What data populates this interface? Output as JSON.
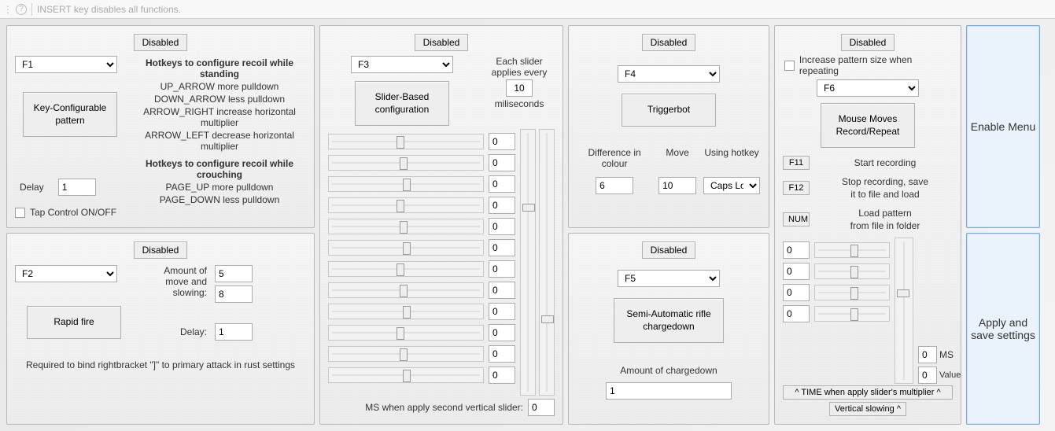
{
  "topbar": {
    "hint": "INSERT key disables all functions."
  },
  "common": {
    "disabled": "Disabled"
  },
  "p1": {
    "hotkey": "F1",
    "btn": "Key-Configurable pattern",
    "h1": "Hotkeys to configure recoil while standing",
    "l1": "UP_ARROW more pulldown",
    "l2": "DOWN_ARROW less pulldown",
    "l3": "ARROW_RIGHT increase horizontal multiplier",
    "l4": "ARROW_LEFT decrease horizontal multiplier",
    "h2": "Hotkeys to configure recoil while crouching",
    "l5": "PAGE_UP more pulldown",
    "l6": "PAGE_DOWN less pulldown",
    "delayLabel": "Delay",
    "delay": "1",
    "tap": "Tap Control ON/OFF"
  },
  "p2": {
    "hotkey": "F2",
    "btn": "Rapid fire",
    "amountLabel": "Amount of move and slowing:",
    "amount1": "5",
    "amount2": "8",
    "delayLabel": "Delay:",
    "delay": "1",
    "note": "Required to bind rightbracket \"]\" to primary attack in rust settings"
  },
  "p3": {
    "hotkey": "F3",
    "btn": "Slider-Based configuration",
    "note1a": "Each slider",
    "note1b": "applies every",
    "ms": "10",
    "note1c": "miliseconds",
    "rows": [
      "0",
      "0",
      "0",
      "0",
      "0",
      "0",
      "0",
      "0",
      "0",
      "0",
      "0",
      "0"
    ],
    "footer": "MS when apply second vertical slider:",
    "footerVal": "0"
  },
  "p4": {
    "hotkey": "F4",
    "btn": "Triggerbot",
    "col1": "Difference in colour",
    "col2": "Move",
    "col3": "Using hotkey",
    "v1": "6",
    "v2": "10",
    "v3": "Caps Lock"
  },
  "p5": {
    "hotkey": "F5",
    "btn": "Semi-Automatic rifle chargedown",
    "label": "Amount of chargedown",
    "val": "1"
  },
  "p6": {
    "chk": "Increase pattern size when repeating",
    "hotkey": "F6",
    "btn": "Mouse Moves Record/Repeat",
    "k1": "F11",
    "t1": "Start recording",
    "k2": "F12",
    "t2a": "Stop recording, save",
    "t2b": "it to file and load",
    "k3": "NUM",
    "t3a": "Load pattern",
    "t3b": "from file in folder",
    "row1": "0",
    "row2": "0",
    "row3": "0",
    "row4": "0",
    "msLabel": "MS",
    "msVal": "0",
    "valueLabel": "Value",
    "valueVal": "0",
    "foot1": "^ TIME when apply slider's multiplier ^",
    "foot2": "Vertical slowing ^"
  },
  "side": {
    "enable": "Enable Menu",
    "apply": "Apply and save settings"
  }
}
